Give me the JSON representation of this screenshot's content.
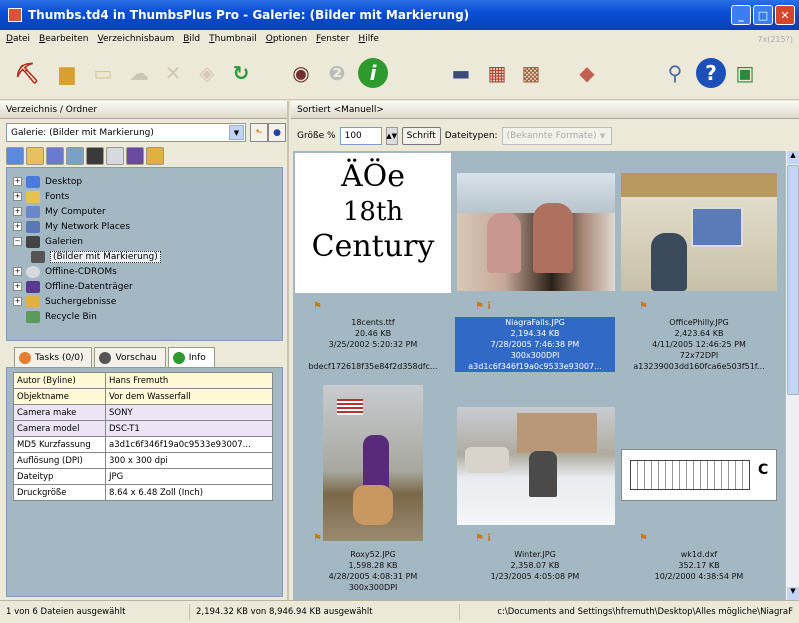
{
  "window": {
    "title": "Thumbs.td4 in ThumbsPlus Pro - Galerie: (Bilder mit Markierung)"
  },
  "menu": [
    "Datei",
    "Bearbeiten",
    "Verzeichnisbaum",
    "Bild",
    "Thumbnail",
    "Optionen",
    "Fenster",
    "Hilfe"
  ],
  "menu_zoom": "7x(215?)",
  "toolbar_icons": [
    "scanner-icon",
    "folder-icon",
    "copy-icon",
    "move-icon",
    "delete-icon",
    "tag-icon",
    "refresh-icon",
    "view-eye-icon",
    "slideshow-icon",
    "info-icon",
    "monitor-icon",
    "contact-sheet-icon",
    "print-icon",
    "eraser-icon",
    "search-icon",
    "help-icon",
    "about-icon"
  ],
  "left": {
    "panel_title": "Verzeichnis / Ordner",
    "combo_value": "Galerie: (Bilder mit Markierung)",
    "tree": [
      {
        "label": "Desktop",
        "pm": "+"
      },
      {
        "label": "Fonts",
        "pm": "+"
      },
      {
        "label": "My Computer",
        "pm": "+"
      },
      {
        "label": "My Network Places",
        "pm": "+"
      },
      {
        "label": "Galerien",
        "pm": "−"
      },
      {
        "label": "(Bilder mit Markierung)",
        "pm": ""
      },
      {
        "label": "Offline-CDROMs",
        "pm": "+"
      },
      {
        "label": "Offline-Datenträger",
        "pm": "+"
      },
      {
        "label": "Suchergebnisse",
        "pm": "+"
      },
      {
        "label": "Recycle Bin",
        "pm": ""
      }
    ],
    "tabs": {
      "tasks": "Tasks (0/0)",
      "preview": "Vorschau",
      "info": "Info"
    },
    "info": [
      {
        "k": "Autor (Byline)",
        "v": "Hans Fremuth",
        "tone": "y"
      },
      {
        "k": "Objektname",
        "v": "Vor dem Wasserfall",
        "tone": "y"
      },
      {
        "k": "Camera make",
        "v": "SONY",
        "tone": "p"
      },
      {
        "k": "Camera model",
        "v": "DSC-T1",
        "tone": "p"
      },
      {
        "k": "MD5 Kurzfassung",
        "v": "a3d1c6f346f19a0c9533e93007...",
        "tone": ""
      },
      {
        "k": "Auflösung (DPI)",
        "v": "300 x 300 dpi",
        "tone": ""
      },
      {
        "k": "Dateityp",
        "v": "JPG",
        "tone": ""
      },
      {
        "k": "Druckgröße",
        "v": "8.64 x 6.48 Zoll (Inch)",
        "tone": ""
      }
    ]
  },
  "right": {
    "sort_label": "Sortiert <Manuell>",
    "size_label": "Größe %",
    "size_value": "100",
    "font_button": "Schrift",
    "filetypes_label": "Dateitypen:",
    "filetypes_value": "(Bekannte Formate)",
    "font_preview": {
      "line1": "ÄÖe",
      "line2": "18th",
      "line3": "Century"
    },
    "items": [
      {
        "name": "18cents.ttf",
        "size": "20.46 KB",
        "date": "3/25/2002  5:20:32 PM",
        "extra": "",
        "md5": "bdecf172618f35e84f2d358dfc...",
        "flags": "⚑"
      },
      {
        "name": "NiagraFalls.JPG",
        "size": "2,194.34 KB",
        "date": "7/28/2005  7:46:38 PM",
        "extra": "300x300DPI",
        "md5": "a3d1c6f346f19a0c9533e93007...",
        "flags": "⚑ i"
      },
      {
        "name": "OfficePhilly.JPG",
        "size": "2,423.64 KB",
        "date": "4/11/2005 12:46:25 PM",
        "extra": "72x72DPI",
        "md5": "a13239003dd160fca6e503f51f...",
        "flags": "⚑"
      },
      {
        "name": "Roxy52.JPG",
        "size": "1,598.28 KB",
        "date": "4/28/2005  4:08:31 PM",
        "extra": "300x300DPI",
        "md5": "",
        "flags": "⚑"
      },
      {
        "name": "Winter.JPG",
        "size": "2,358.07 KB",
        "date": "1/23/2005  4:05:08 PM",
        "extra": "",
        "md5": "",
        "flags": "⚑ i"
      },
      {
        "name": "wk1d.dxf",
        "size": "352.17 KB",
        "date": "10/2/2000  4:38:54 PM",
        "extra": "",
        "md5": "",
        "flags": "⚑"
      }
    ]
  },
  "status": {
    "selection": "1 von 6 Dateien ausgewählt",
    "bytes": "2,194.32 KB von 8,946.94 KB ausgewählt",
    "path": "c:\\Documents and Settings\\hfremuth\\Desktop\\Alles mögliche\\NiagraF"
  }
}
